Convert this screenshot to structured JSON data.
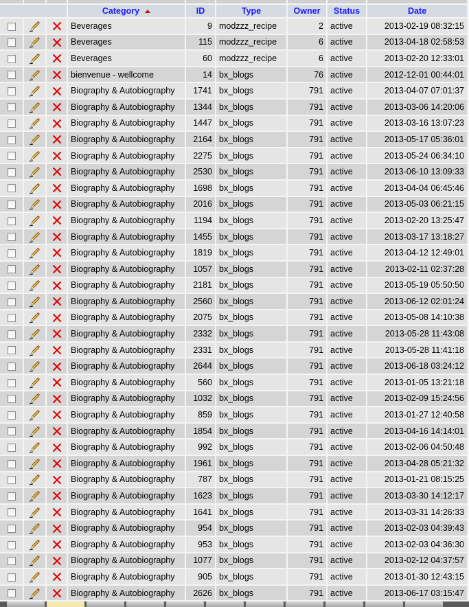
{
  "columns": {
    "category": "Category",
    "id": "ID",
    "type": "Type",
    "owner": "Owner",
    "status": "Status",
    "date": "Date"
  },
  "sort": {
    "column": "Category",
    "direction": "asc"
  },
  "colors": {
    "header_bg": "#d4dbe3",
    "header_text": "#1a1aff",
    "row_odd": "#e5e5e5",
    "row_even": "#d5d5d5",
    "delete": "#e00000"
  },
  "rows": [
    {
      "category": "Beverages",
      "id": "9",
      "type": "modzzz_recipe",
      "owner": "2",
      "status": "active",
      "date": "2013-02-19 08:32:15"
    },
    {
      "category": "Beverages",
      "id": "115",
      "type": "modzzz_recipe",
      "owner": "6",
      "status": "active",
      "date": "2013-04-18 02:58:53"
    },
    {
      "category": "Beverages",
      "id": "60",
      "type": "modzzz_recipe",
      "owner": "6",
      "status": "active",
      "date": "2013-02-20 12:33:01"
    },
    {
      "category": "bienvenue - wellcome",
      "id": "14",
      "type": "bx_blogs",
      "owner": "76",
      "status": "active",
      "date": "2012-12-01 00:44:01"
    },
    {
      "category": "Biography & Autobiography",
      "id": "1741",
      "type": "bx_blogs",
      "owner": "791",
      "status": "active",
      "date": "2013-04-07 07:01:37"
    },
    {
      "category": "Biography & Autobiography",
      "id": "1344",
      "type": "bx_blogs",
      "owner": "791",
      "status": "active",
      "date": "2013-03-06 14:20:06"
    },
    {
      "category": "Biography & Autobiography",
      "id": "1447",
      "type": "bx_blogs",
      "owner": "791",
      "status": "active",
      "date": "2013-03-16 13:07:23"
    },
    {
      "category": "Biography & Autobiography",
      "id": "2164",
      "type": "bx_blogs",
      "owner": "791",
      "status": "active",
      "date": "2013-05-17 05:36:01"
    },
    {
      "category": "Biography & Autobiography",
      "id": "2275",
      "type": "bx_blogs",
      "owner": "791",
      "status": "active",
      "date": "2013-05-24 06:34:10"
    },
    {
      "category": "Biography & Autobiography",
      "id": "2530",
      "type": "bx_blogs",
      "owner": "791",
      "status": "active",
      "date": "2013-06-10 13:09:33"
    },
    {
      "category": "Biography & Autobiography",
      "id": "1698",
      "type": "bx_blogs",
      "owner": "791",
      "status": "active",
      "date": "2013-04-04 06:45:46"
    },
    {
      "category": "Biography & Autobiography",
      "id": "2016",
      "type": "bx_blogs",
      "owner": "791",
      "status": "active",
      "date": "2013-05-03 06:21:15"
    },
    {
      "category": "Biography & Autobiography",
      "id": "1194",
      "type": "bx_blogs",
      "owner": "791",
      "status": "active",
      "date": "2013-02-20 13:25:47"
    },
    {
      "category": "Biography & Autobiography",
      "id": "1455",
      "type": "bx_blogs",
      "owner": "791",
      "status": "active",
      "date": "2013-03-17 13:18:27"
    },
    {
      "category": "Biography & Autobiography",
      "id": "1819",
      "type": "bx_blogs",
      "owner": "791",
      "status": "active",
      "date": "2013-04-12 12:49:01"
    },
    {
      "category": "Biography & Autobiography",
      "id": "1057",
      "type": "bx_blogs",
      "owner": "791",
      "status": "active",
      "date": "2013-02-11 02:37:28"
    },
    {
      "category": "Biography & Autobiography",
      "id": "2181",
      "type": "bx_blogs",
      "owner": "791",
      "status": "active",
      "date": "2013-05-19 05:50:50"
    },
    {
      "category": "Biography & Autobiography",
      "id": "2560",
      "type": "bx_blogs",
      "owner": "791",
      "status": "active",
      "date": "2013-06-12 02:01:24"
    },
    {
      "category": "Biography & Autobiography",
      "id": "2075",
      "type": "bx_blogs",
      "owner": "791",
      "status": "active",
      "date": "2013-05-08 14:10:38"
    },
    {
      "category": "Biography & Autobiography",
      "id": "2332",
      "type": "bx_blogs",
      "owner": "791",
      "status": "active",
      "date": "2013-05-28 11:43:08"
    },
    {
      "category": "Biography & Autobiography",
      "id": "2331",
      "type": "bx_blogs",
      "owner": "791",
      "status": "active",
      "date": "2013-05-28 11:41:18"
    },
    {
      "category": "Biography & Autobiography",
      "id": "2644",
      "type": "bx_blogs",
      "owner": "791",
      "status": "active",
      "date": "2013-06-18 03:24:12"
    },
    {
      "category": "Biography & Autobiography",
      "id": "560",
      "type": "bx_blogs",
      "owner": "791",
      "status": "active",
      "date": "2013-01-05 13:21:18"
    },
    {
      "category": "Biography & Autobiography",
      "id": "1032",
      "type": "bx_blogs",
      "owner": "791",
      "status": "active",
      "date": "2013-02-09 15:24:56"
    },
    {
      "category": "Biography & Autobiography",
      "id": "859",
      "type": "bx_blogs",
      "owner": "791",
      "status": "active",
      "date": "2013-01-27 12:40:58"
    },
    {
      "category": "Biography & Autobiography",
      "id": "1854",
      "type": "bx_blogs",
      "owner": "791",
      "status": "active",
      "date": "2013-04-16 14:14:01"
    },
    {
      "category": "Biography & Autobiography",
      "id": "992",
      "type": "bx_blogs",
      "owner": "791",
      "status": "active",
      "date": "2013-02-06 04:50:48"
    },
    {
      "category": "Biography & Autobiography",
      "id": "1961",
      "type": "bx_blogs",
      "owner": "791",
      "status": "active",
      "date": "2013-04-28 05:21:32"
    },
    {
      "category": "Biography & Autobiography",
      "id": "787",
      "type": "bx_blogs",
      "owner": "791",
      "status": "active",
      "date": "2013-01-21 08:15:25"
    },
    {
      "category": "Biography & Autobiography",
      "id": "1623",
      "type": "bx_blogs",
      "owner": "791",
      "status": "active",
      "date": "2013-03-30 14:12:17"
    },
    {
      "category": "Biography & Autobiography",
      "id": "1641",
      "type": "bx_blogs",
      "owner": "791",
      "status": "active",
      "date": "2013-03-31 14:26:33"
    },
    {
      "category": "Biography & Autobiography",
      "id": "954",
      "type": "bx_blogs",
      "owner": "791",
      "status": "active",
      "date": "2013-02-03 04:39:43"
    },
    {
      "category": "Biography & Autobiography",
      "id": "953",
      "type": "bx_blogs",
      "owner": "791",
      "status": "active",
      "date": "2013-02-03 04:36:30"
    },
    {
      "category": "Biography & Autobiography",
      "id": "1077",
      "type": "bx_blogs",
      "owner": "791",
      "status": "active",
      "date": "2013-02-12 04:37:57"
    },
    {
      "category": "Biography & Autobiography",
      "id": "905",
      "type": "bx_blogs",
      "owner": "791",
      "status": "active",
      "date": "2013-01-30 12:43:15"
    },
    {
      "category": "Biography & Autobiography",
      "id": "2626",
      "type": "bx_blogs",
      "owner": "791",
      "status": "active",
      "date": "2013-06-17 03:15:47"
    }
  ]
}
